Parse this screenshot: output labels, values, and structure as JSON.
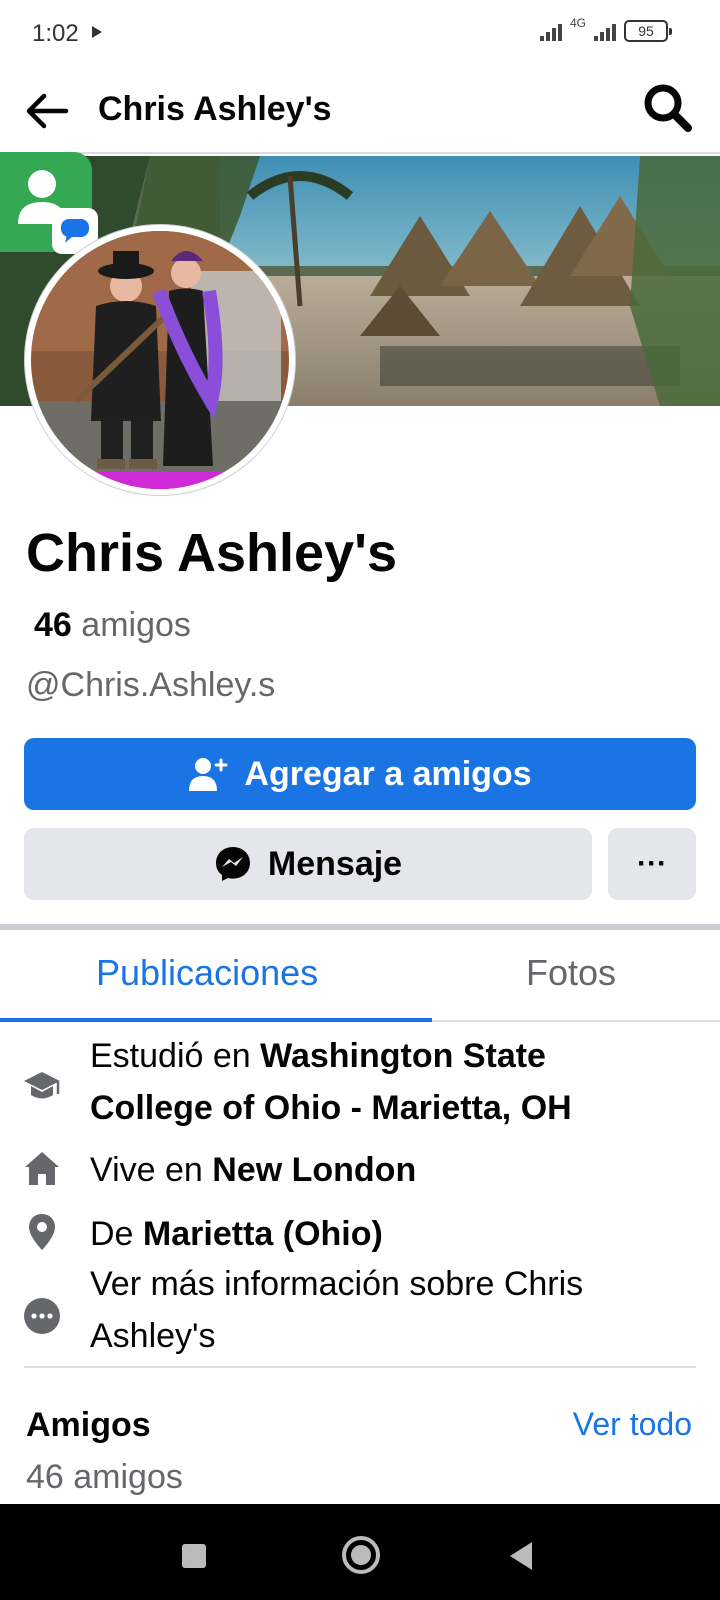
{
  "status_bar": {
    "time": "1:02",
    "network": "4G",
    "battery": "95"
  },
  "header": {
    "title": "Chris Ashley's",
    "back_icon": "arrow-left-icon",
    "search_icon": "search-icon"
  },
  "profile": {
    "name": "Chris Ashley's",
    "friends_count": "46",
    "friends_word": "amigos",
    "username": "@Chris.Ashley.s"
  },
  "actions": {
    "add_friend_label": "Agregar a amigos",
    "message_label": "Mensaje",
    "more_label": "···"
  },
  "tabs": [
    {
      "label": "Publicaciones",
      "active": true
    },
    {
      "label": "Fotos",
      "active": false
    }
  ],
  "details": {
    "education_prefix": "Estudió en",
    "education_place_line1": "Washington State",
    "education_place_line2": "College of Ohio - Marietta, OH",
    "lives_prefix": "Vive en",
    "lives_place": "New London",
    "from_prefix": "De",
    "from_place": "Marietta (Ohio)",
    "more_info_line1": "Ver más información sobre Chris",
    "more_info_line2": "Ashley's"
  },
  "friends_section": {
    "title": "Amigos",
    "see_all": "Ver todo",
    "count_text": "46 amigos"
  },
  "colors": {
    "primary": "#1b74e4",
    "secondary_button": "#e4e6eb",
    "muted_text": "#65676b"
  }
}
